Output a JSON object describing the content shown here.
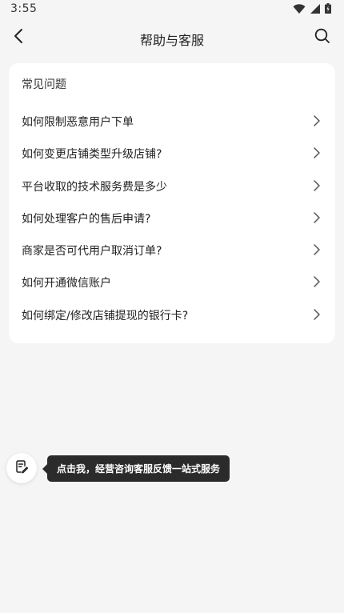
{
  "status_bar": {
    "time": "3:55",
    "icons": [
      "wifi-icon",
      "cell-signal-icon",
      "battery-icon"
    ]
  },
  "header": {
    "title": "帮助与客服",
    "back_icon": "chevron-left-icon",
    "search_icon": "search-icon"
  },
  "faq": {
    "heading": "常见问题",
    "items": [
      {
        "label": "如何限制恶意用户下单"
      },
      {
        "label": "如何变更店铺类型升级店铺?"
      },
      {
        "label": "平台收取的技术服务费是多少"
      },
      {
        "label": "如何处理客户的售后申请?"
      },
      {
        "label": "商家是否可代用户取消订单?"
      },
      {
        "label": "如何开通微信账户"
      },
      {
        "label": "如何绑定/修改店铺提现的银行卡?"
      }
    ]
  },
  "service": {
    "icon": "feedback-icon",
    "tooltip": "点击我，经营咨询客服反馈一站式服务"
  },
  "colors": {
    "background": "#f5f5f5",
    "card": "#ffffff",
    "text": "#222222",
    "tooltip_bg": "#2b2b2b"
  }
}
